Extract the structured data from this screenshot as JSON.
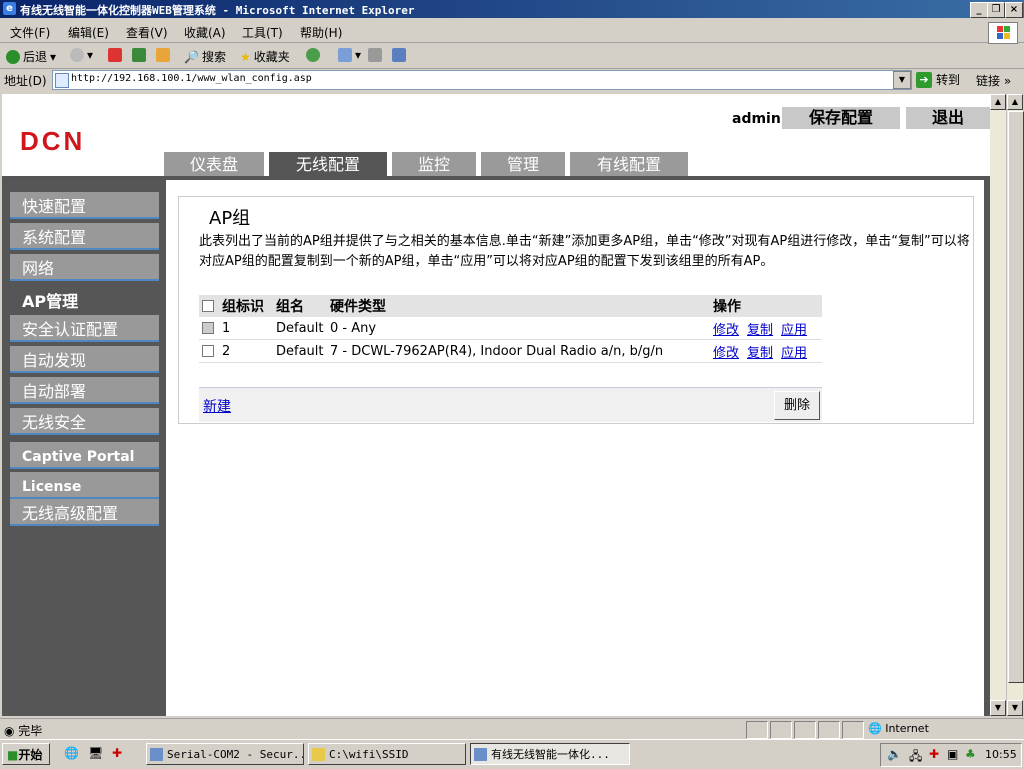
{
  "window": {
    "title": "有线无线智能一体化控制器WEB管理系统 - Microsoft Internet Explorer"
  },
  "menu": [
    "文件(F)",
    "编辑(E)",
    "查看(V)",
    "收藏(A)",
    "工具(T)",
    "帮助(H)"
  ],
  "toolbar": {
    "back": "后退",
    "search": "搜索",
    "favorites": "收藏夹"
  },
  "address": {
    "label": "地址(D)",
    "url": "http://192.168.100.1/www_wlan_config.asp",
    "go": "转到",
    "links": "链接"
  },
  "page": {
    "logo": "DCN",
    "user": "admin",
    "save_label": "保存配置",
    "logout_label": "退出",
    "tabs": [
      "仪表盘",
      "无线配置",
      "监控",
      "管理",
      "有线配置"
    ],
    "active_tab": "无线配置",
    "sidebar": [
      "快速配置",
      "系统配置",
      "网络",
      "AP管理",
      "安全认证配置",
      "自动发现",
      "自动部署",
      "无线安全",
      "Captive Portal",
      "License",
      "无线高级配置"
    ],
    "active_sidebar": "AP管理",
    "section_title": "AP组",
    "description": "此表列出了当前的AP组并提供了与之相关的基本信息.单击“新建”添加更多AP组，单击“修改”对现有AP组进行修改，单击“复制”可以将对应AP组的配置复制到一个新的AP组，单击“应用”可以将对应AP组的配置下发到该组里的所有AP。",
    "table": {
      "headers": [
        "组标识",
        "组名",
        "硬件类型",
        "操作"
      ],
      "rows": [
        {
          "id": "1",
          "name": "Default",
          "hardware": "0 - Any",
          "actions": [
            "修改",
            "复制",
            "应用"
          ]
        },
        {
          "id": "2",
          "name": "Default",
          "hardware": "7 - DCWL-7962AP(R4), Indoor Dual Radio a/n, b/g/n",
          "actions": [
            "修改",
            "复制",
            "应用"
          ]
        }
      ]
    },
    "new_label": "新建",
    "delete_label": "删除"
  },
  "status": {
    "text": "完毕",
    "zone": "Internet"
  },
  "taskbar": {
    "start": "开始",
    "tasks": [
      "Serial-COM2 - Secur...",
      "C:\\wifi\\SSID",
      "有线无线智能一体化..."
    ],
    "clock": "10:55"
  }
}
